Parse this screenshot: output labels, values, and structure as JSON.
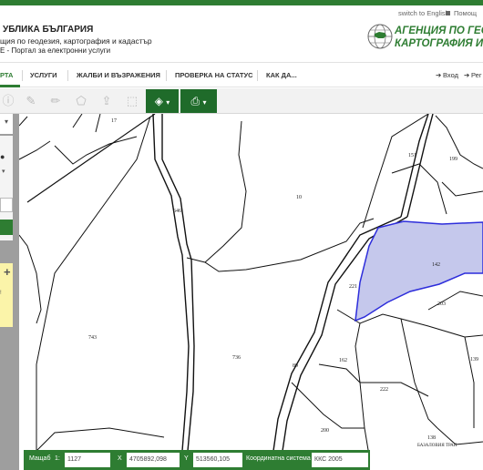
{
  "header": {
    "title_line1": "УБЛИКА БЪЛГАРИЯ",
    "title_line2": "щия по геодезия, картография и кадастър",
    "title_line3": "Е - Портал за електронни услуги",
    "lang_link": "switch to English",
    "help_link": "Помощ",
    "agency_line1": "АГЕНЦИЯ ПО ГЕОД",
    "agency_line2": "КАРТОГРАФИЯ И К"
  },
  "nav": {
    "items": [
      "РТА",
      "УСЛУГИ",
      "ЖАЛБИ И ВЪЗРАЖЕНИЯ",
      "ПРОВЕРКА НА СТАТУС",
      "КАК ДА..."
    ],
    "login": "Вход",
    "register": "Рег"
  },
  "map": {
    "parcel_labels": [
      "17",
      "646",
      "10",
      "151",
      "199",
      "142",
      "221",
      "203",
      "743",
      "736",
      "89",
      "162",
      "139",
      "222",
      "200",
      "138"
    ],
    "area_label": "БАЗАЛОВИЯ ТРАП",
    "selected_fill": "#c5c8ec",
    "selected_stroke": "#2d2ddb"
  },
  "statusbar": {
    "scale_label": "Мащаб",
    "scale_prefix": "1:",
    "scale_value": "1127",
    "x_label": "X",
    "x_value": "4705892,098",
    "y_label": "Y",
    "y_value": "513560,105",
    "crs_label": "Координатна система",
    "crs_value": "ККС 2005"
  },
  "colors": {
    "brand_green": "#2e7d32",
    "dark_green": "#1f6b2a",
    "panel_gray": "#9e9e9e"
  }
}
